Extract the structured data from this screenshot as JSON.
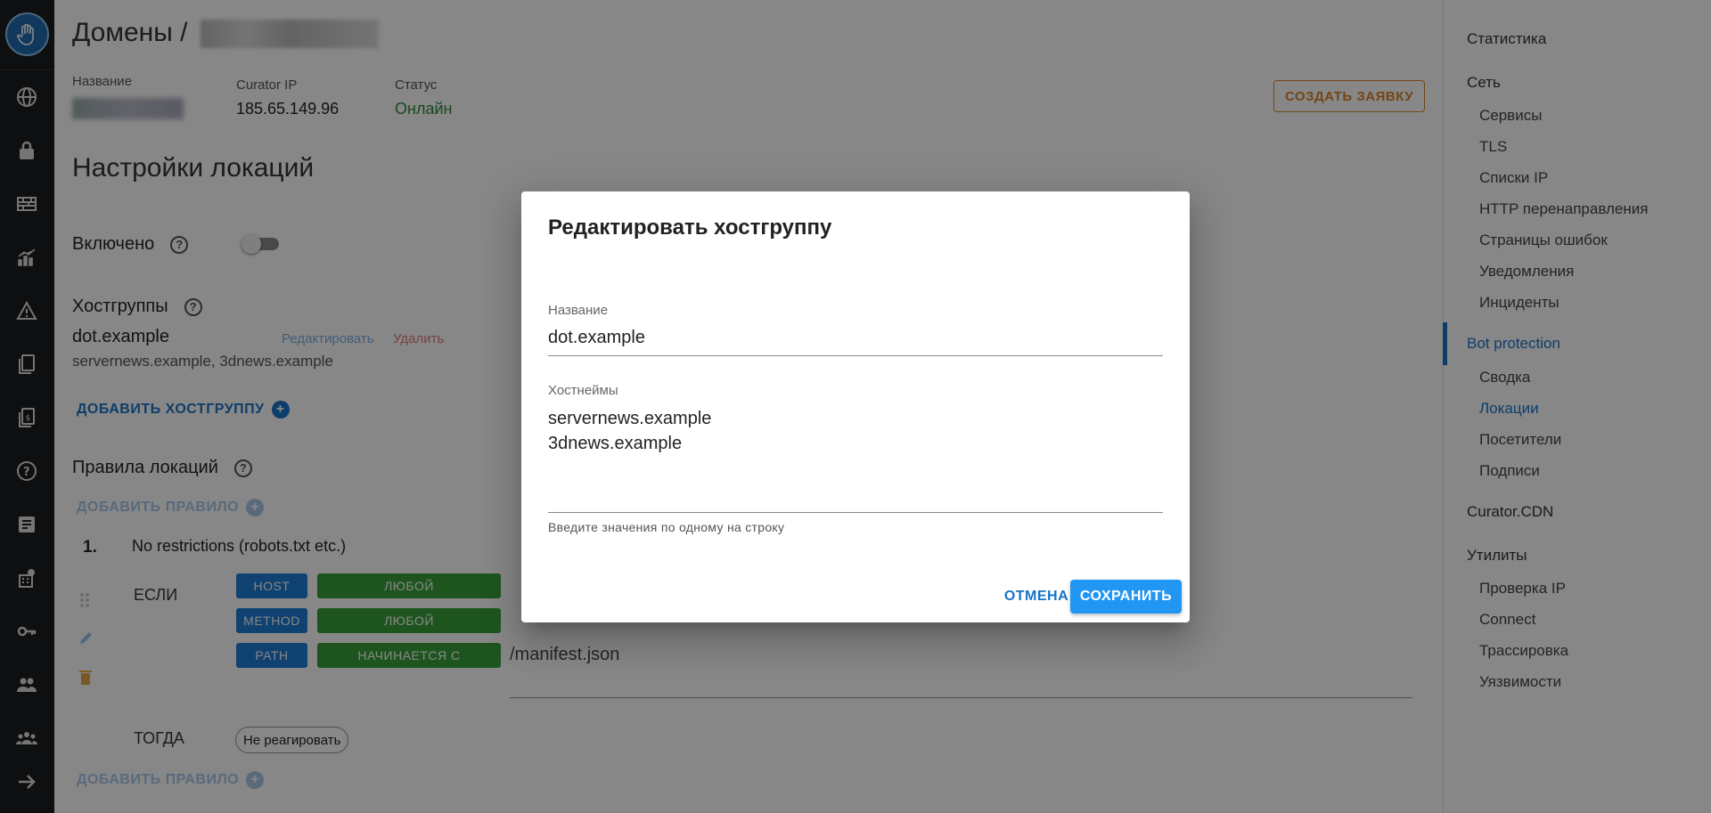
{
  "breadcrumb": {
    "root": "Домены",
    "separator": "/"
  },
  "meta": {
    "name_label": "Название",
    "ip_label": "Curator IP",
    "ip_value": "185.65.149.96",
    "status_label": "Статус",
    "status_value": "Онлайн"
  },
  "create_request_label": "СОЗДАТЬ ЗАЯВКУ",
  "section_title": "Настройки локаций",
  "enabled_label": "Включено",
  "hostgroups": {
    "label": "Хостгруппы",
    "name": "dot.example",
    "hosts": "servernews.example, 3dnews.example",
    "edit_label": "Редактировать",
    "delete_label": "Удалить",
    "add_label": "ДОБАВИТЬ ХОСТГРУППУ"
  },
  "rules": {
    "label": "Правила локаций",
    "add_rule_label": "ДОБАВИТЬ ПРАВИЛО",
    "rule_number": "1.",
    "rule_title": "No restrictions (robots.txt etc.)",
    "if_label": "ЕСЛИ",
    "then_label": "ТОГДА",
    "conditions": [
      {
        "field": "HOST",
        "op": "ЛЮБОЙ"
      },
      {
        "field": "METHOD",
        "op": "ЛЮБОЙ"
      },
      {
        "field": "PATH",
        "op": "НАЧИНАЕТСЯ С"
      }
    ],
    "path_value": "/manifest.json",
    "action": "Не реагировать"
  },
  "right_nav": {
    "stats": "Статистика",
    "network": "Сеть",
    "network_items": [
      "Сервисы",
      "TLS",
      "Списки IP",
      "HTTP перенаправления",
      "Страницы ошибок",
      "Уведомления",
      "Инциденты"
    ],
    "bot_protection": "Bot protection",
    "bot_items": [
      "Сводка",
      "Локации",
      "Посетители",
      "Подписи"
    ],
    "cdn": "Curator.CDN",
    "utils": "Утилиты",
    "util_items": [
      "Проверка IP",
      "Connect",
      "Трассировка",
      "Уязвимости"
    ]
  },
  "dialog": {
    "title": "Редактировать хостгруппу",
    "name_label": "Название",
    "name_value": "dot.example",
    "hostnames_label": "Хостнеймы",
    "hostname_1": "servernews.example",
    "hostname_2": "3dnews.example",
    "hint": "Введите значения по одному на строку",
    "cancel_label": "ОТМЕНА",
    "save_label": "СОХРАНИТЬ"
  },
  "colors": {
    "accent": "#1a73c9",
    "save_button": "#2196f3",
    "status_online": "#2e8b3b",
    "create_request": "#d9822b",
    "chip_field": "#1e7bd6",
    "chip_op": "#3aa13a"
  }
}
